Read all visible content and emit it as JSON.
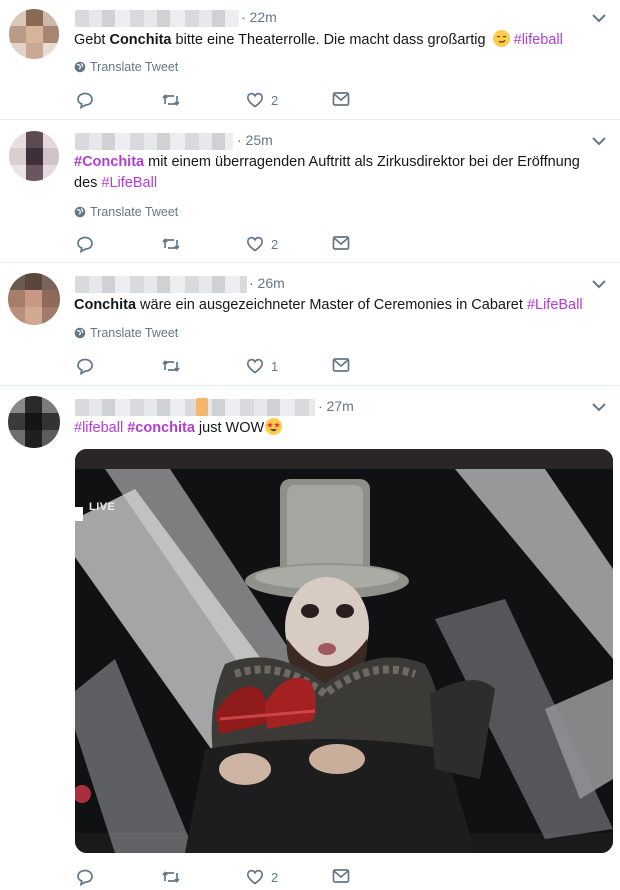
{
  "tweets": [
    {
      "time": "· 22m",
      "text_parts": {
        "pre": "Gebt ",
        "name": "Conchita",
        "post": " bitte eine Theaterrolle. Die macht dass großartig ",
        "hashtag": "#lifeball"
      },
      "emoji": "smirking-face",
      "translate": "Translate Tweet",
      "likes": "2"
    },
    {
      "time": "· 25m",
      "text_parts": {
        "hashtag1": "#Conchita",
        "mid": " mit einem überragenden Auftritt als Zirkusdirektor bei der Eröffnung des ",
        "hashtag2": "#LifeBall"
      },
      "translate": "Translate Tweet",
      "likes": "2"
    },
    {
      "time": "· 26m",
      "text_parts": {
        "name": "Conchita",
        "mid": " wäre ein ausgezeichneter Master of Ceremonies in Cabaret ",
        "hashtag": "#LifeBall"
      },
      "translate": "Translate Tweet",
      "likes": "1"
    },
    {
      "time": "· 27m",
      "text_parts": {
        "hashtag1": "#lifeball",
        "hashtag2": "#conchita",
        "post": " just WOW"
      },
      "emoji": "star-struck-face",
      "media": {
        "live_label": "LIVE"
      },
      "likes": "2"
    }
  ],
  "colors": {
    "hashtag": "#b13ed1",
    "meta": "#657786",
    "divider": "#e6ecf0"
  }
}
